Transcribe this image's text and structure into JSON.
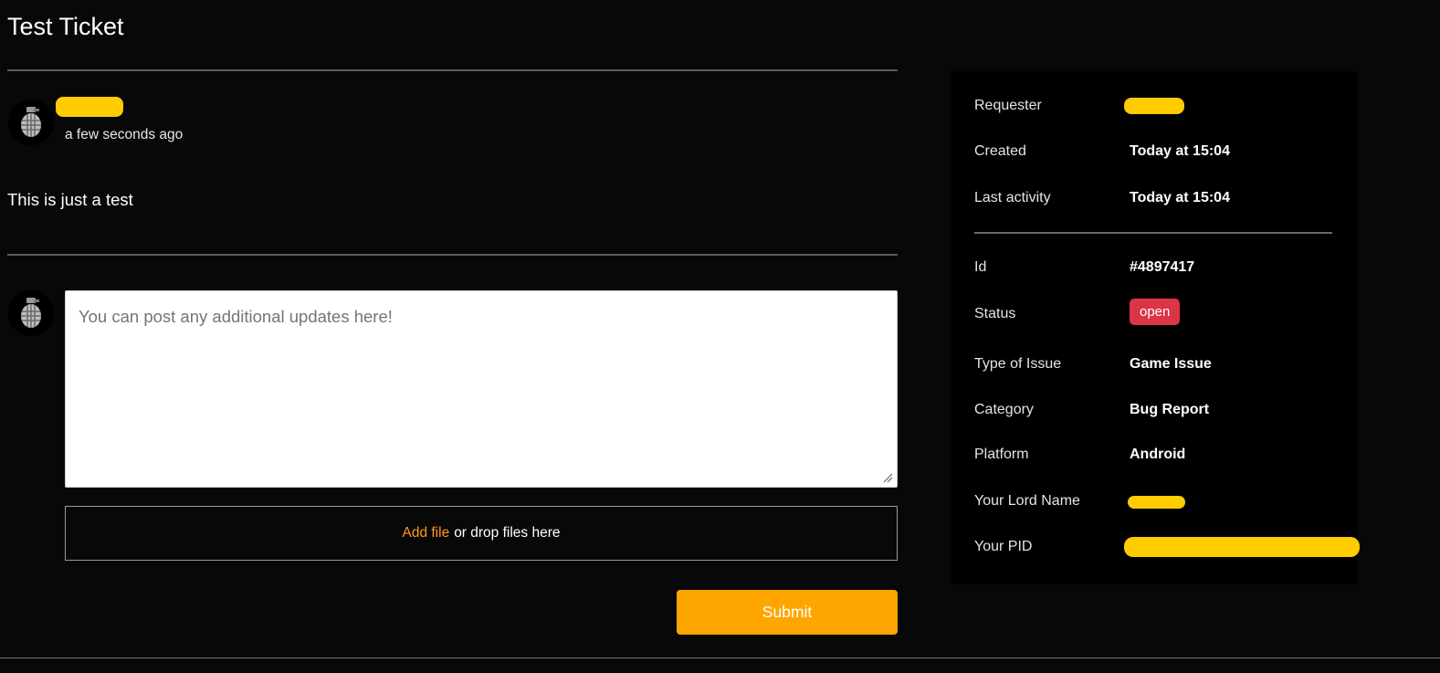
{
  "ticket": {
    "title": "Test Ticket",
    "post": {
      "timestamp": "a few seconds ago",
      "message": "This is just a test"
    }
  },
  "reply": {
    "placeholder": "You can post any additional updates here!",
    "add_file_label": "Add file",
    "drop_label": "or drop files here",
    "submit_label": "Submit"
  },
  "details": {
    "requester_label": "Requester",
    "created_label": "Created",
    "created_value": "Today at 15:04",
    "last_activity_label": "Last activity",
    "last_activity_value": "Today at 15:04",
    "id_label": "Id",
    "id_value": "#4897417",
    "status_label": "Status",
    "status_value": "open",
    "type_label": "Type of Issue",
    "type_value": "Game Issue",
    "category_label": "Category",
    "category_value": "Bug Report",
    "platform_label": "Platform",
    "platform_value": "Android",
    "lord_label": "Your Lord Name",
    "pid_label": "Your PID"
  },
  "colors": {
    "accent": "#ffa500",
    "link": "#ff9a1c",
    "status_open": "#dc3545",
    "redaction": "#ffcc00",
    "background": "#080808"
  },
  "icons": {
    "avatar": "grenade-icon",
    "resize": "resize-grip-icon"
  }
}
